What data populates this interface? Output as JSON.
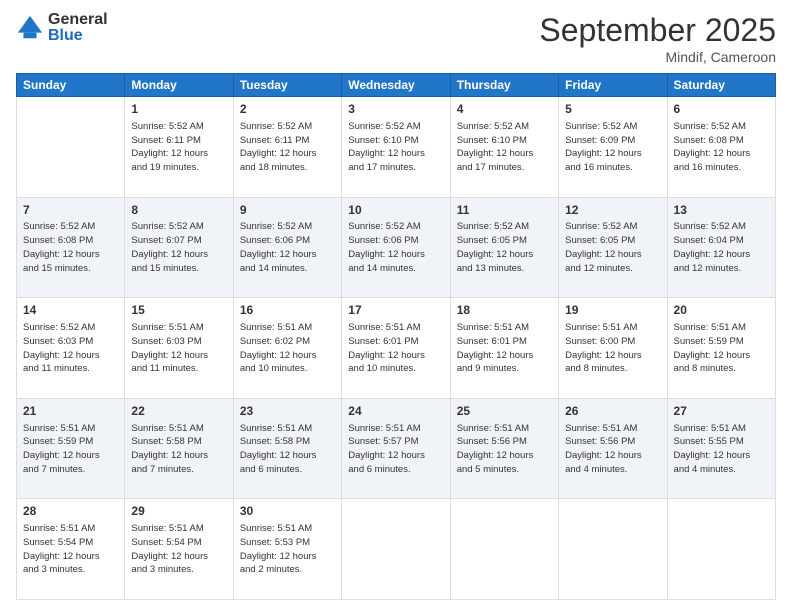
{
  "logo": {
    "general": "General",
    "blue": "Blue"
  },
  "title": "September 2025",
  "location": "Mindif, Cameroon",
  "days_header": [
    "Sunday",
    "Monday",
    "Tuesday",
    "Wednesday",
    "Thursday",
    "Friday",
    "Saturday"
  ],
  "weeks": [
    [
      {
        "day": "",
        "info": ""
      },
      {
        "day": "1",
        "info": "Sunrise: 5:52 AM\nSunset: 6:11 PM\nDaylight: 12 hours\nand 19 minutes."
      },
      {
        "day": "2",
        "info": "Sunrise: 5:52 AM\nSunset: 6:11 PM\nDaylight: 12 hours\nand 18 minutes."
      },
      {
        "day": "3",
        "info": "Sunrise: 5:52 AM\nSunset: 6:10 PM\nDaylight: 12 hours\nand 17 minutes."
      },
      {
        "day": "4",
        "info": "Sunrise: 5:52 AM\nSunset: 6:10 PM\nDaylight: 12 hours\nand 17 minutes."
      },
      {
        "day": "5",
        "info": "Sunrise: 5:52 AM\nSunset: 6:09 PM\nDaylight: 12 hours\nand 16 minutes."
      },
      {
        "day": "6",
        "info": "Sunrise: 5:52 AM\nSunset: 6:08 PM\nDaylight: 12 hours\nand 16 minutes."
      }
    ],
    [
      {
        "day": "7",
        "info": "Sunrise: 5:52 AM\nSunset: 6:08 PM\nDaylight: 12 hours\nand 15 minutes."
      },
      {
        "day": "8",
        "info": "Sunrise: 5:52 AM\nSunset: 6:07 PM\nDaylight: 12 hours\nand 15 minutes."
      },
      {
        "day": "9",
        "info": "Sunrise: 5:52 AM\nSunset: 6:06 PM\nDaylight: 12 hours\nand 14 minutes."
      },
      {
        "day": "10",
        "info": "Sunrise: 5:52 AM\nSunset: 6:06 PM\nDaylight: 12 hours\nand 14 minutes."
      },
      {
        "day": "11",
        "info": "Sunrise: 5:52 AM\nSunset: 6:05 PM\nDaylight: 12 hours\nand 13 minutes."
      },
      {
        "day": "12",
        "info": "Sunrise: 5:52 AM\nSunset: 6:05 PM\nDaylight: 12 hours\nand 12 minutes."
      },
      {
        "day": "13",
        "info": "Sunrise: 5:52 AM\nSunset: 6:04 PM\nDaylight: 12 hours\nand 12 minutes."
      }
    ],
    [
      {
        "day": "14",
        "info": "Sunrise: 5:52 AM\nSunset: 6:03 PM\nDaylight: 12 hours\nand 11 minutes."
      },
      {
        "day": "15",
        "info": "Sunrise: 5:51 AM\nSunset: 6:03 PM\nDaylight: 12 hours\nand 11 minutes."
      },
      {
        "day": "16",
        "info": "Sunrise: 5:51 AM\nSunset: 6:02 PM\nDaylight: 12 hours\nand 10 minutes."
      },
      {
        "day": "17",
        "info": "Sunrise: 5:51 AM\nSunset: 6:01 PM\nDaylight: 12 hours\nand 10 minutes."
      },
      {
        "day": "18",
        "info": "Sunrise: 5:51 AM\nSunset: 6:01 PM\nDaylight: 12 hours\nand 9 minutes."
      },
      {
        "day": "19",
        "info": "Sunrise: 5:51 AM\nSunset: 6:00 PM\nDaylight: 12 hours\nand 8 minutes."
      },
      {
        "day": "20",
        "info": "Sunrise: 5:51 AM\nSunset: 5:59 PM\nDaylight: 12 hours\nand 8 minutes."
      }
    ],
    [
      {
        "day": "21",
        "info": "Sunrise: 5:51 AM\nSunset: 5:59 PM\nDaylight: 12 hours\nand 7 minutes."
      },
      {
        "day": "22",
        "info": "Sunrise: 5:51 AM\nSunset: 5:58 PM\nDaylight: 12 hours\nand 7 minutes."
      },
      {
        "day": "23",
        "info": "Sunrise: 5:51 AM\nSunset: 5:58 PM\nDaylight: 12 hours\nand 6 minutes."
      },
      {
        "day": "24",
        "info": "Sunrise: 5:51 AM\nSunset: 5:57 PM\nDaylight: 12 hours\nand 6 minutes."
      },
      {
        "day": "25",
        "info": "Sunrise: 5:51 AM\nSunset: 5:56 PM\nDaylight: 12 hours\nand 5 minutes."
      },
      {
        "day": "26",
        "info": "Sunrise: 5:51 AM\nSunset: 5:56 PM\nDaylight: 12 hours\nand 4 minutes."
      },
      {
        "day": "27",
        "info": "Sunrise: 5:51 AM\nSunset: 5:55 PM\nDaylight: 12 hours\nand 4 minutes."
      }
    ],
    [
      {
        "day": "28",
        "info": "Sunrise: 5:51 AM\nSunset: 5:54 PM\nDaylight: 12 hours\nand 3 minutes."
      },
      {
        "day": "29",
        "info": "Sunrise: 5:51 AM\nSunset: 5:54 PM\nDaylight: 12 hours\nand 3 minutes."
      },
      {
        "day": "30",
        "info": "Sunrise: 5:51 AM\nSunset: 5:53 PM\nDaylight: 12 hours\nand 2 minutes."
      },
      {
        "day": "",
        "info": ""
      },
      {
        "day": "",
        "info": ""
      },
      {
        "day": "",
        "info": ""
      },
      {
        "day": "",
        "info": ""
      }
    ]
  ]
}
